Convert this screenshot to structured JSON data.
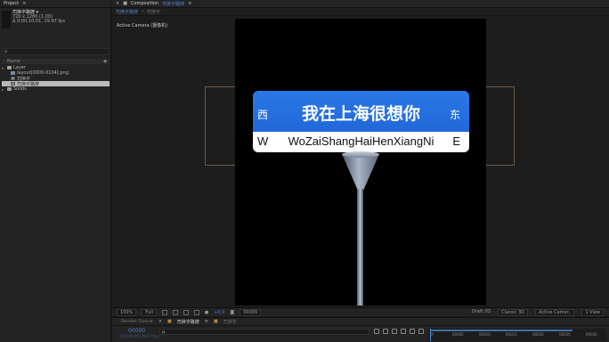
{
  "project_panel": {
    "tab_label": "Project",
    "selected_item": {
      "name": "司换字路牌 ▾",
      "dimensions": "720 x 1280 (1.00)",
      "duration": "Δ 0;00;10;01, 29.97 fps"
    },
    "search_placeholder": "ρ.",
    "column_name": "Name",
    "items": [
      {
        "label": "Layer",
        "type": "folder",
        "indent": 0
      },
      {
        "label": "layout[0000-0104].png",
        "type": "image",
        "indent": 1
      },
      {
        "label": "司换字",
        "type": "composition",
        "indent": 1
      },
      {
        "label": "司换字路牌",
        "type": "composition",
        "indent": 1,
        "selected": true
      },
      {
        "label": "Solids",
        "type": "folder",
        "indent": 0
      }
    ]
  },
  "composition_panel": {
    "tab_prefix": "Composition",
    "tab_name": "司换字路牌",
    "breadcrumbs": [
      "司换字路牌",
      "司换字"
    ],
    "active_camera_label": "Active Camera (摄像机)",
    "sign": {
      "main_text": "我在上海很想你",
      "west_cn": "西",
      "east_cn": "东",
      "west_en": "W",
      "east_en": "E",
      "pinyin": "WoZaiShangHaiHenXiangNi"
    },
    "toolbar": {
      "zoom": "100%",
      "resolution": "Full",
      "exposure": "+0.0",
      "timecode": "00000",
      "renderer": "Draft 3D",
      "view_mode": "Classic 3D",
      "camera": "Active Camer..",
      "views": "1 View"
    },
    "colors": {
      "sign_blue": "#2168d9",
      "accent_blue": "#4f7fc9"
    }
  },
  "timeline_panel": {
    "tabs": [
      "Render Queue",
      "司换字路牌",
      "司换字"
    ],
    "current_time": "00000",
    "current_time_sub": "0;00;00;00 (29.97 fps)",
    "search_placeholder": "ρ.",
    "ruler_ticks": [
      "00005",
      "00010",
      "00015",
      "00020",
      "00025",
      "00030"
    ],
    "ruler_start": "0f"
  }
}
